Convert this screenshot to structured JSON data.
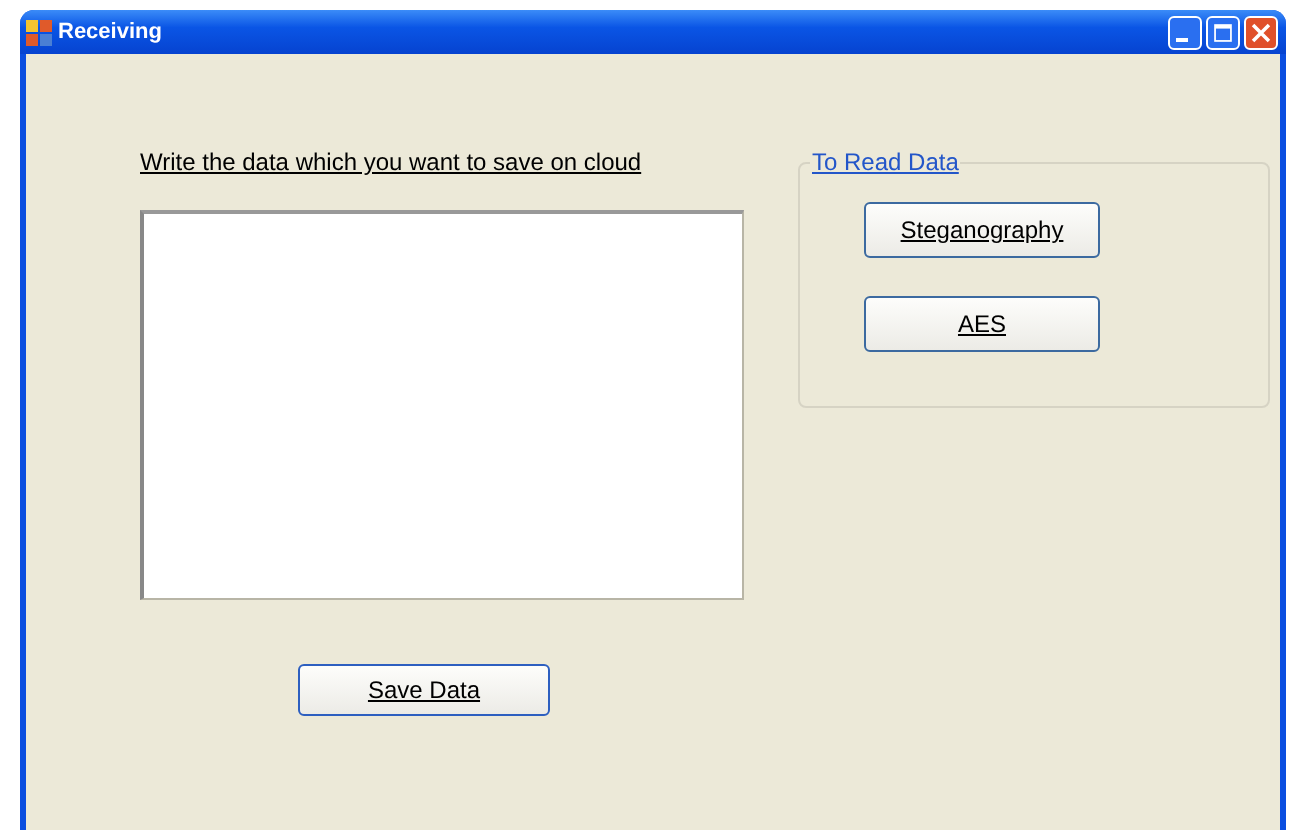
{
  "window": {
    "title": "Receiving"
  },
  "prompt": "Write the data which you want to save on cloud",
  "save_button": "Save Data",
  "read_group": {
    "title": "To Read Data",
    "buttons": [
      "Steganography",
      "AES"
    ]
  }
}
